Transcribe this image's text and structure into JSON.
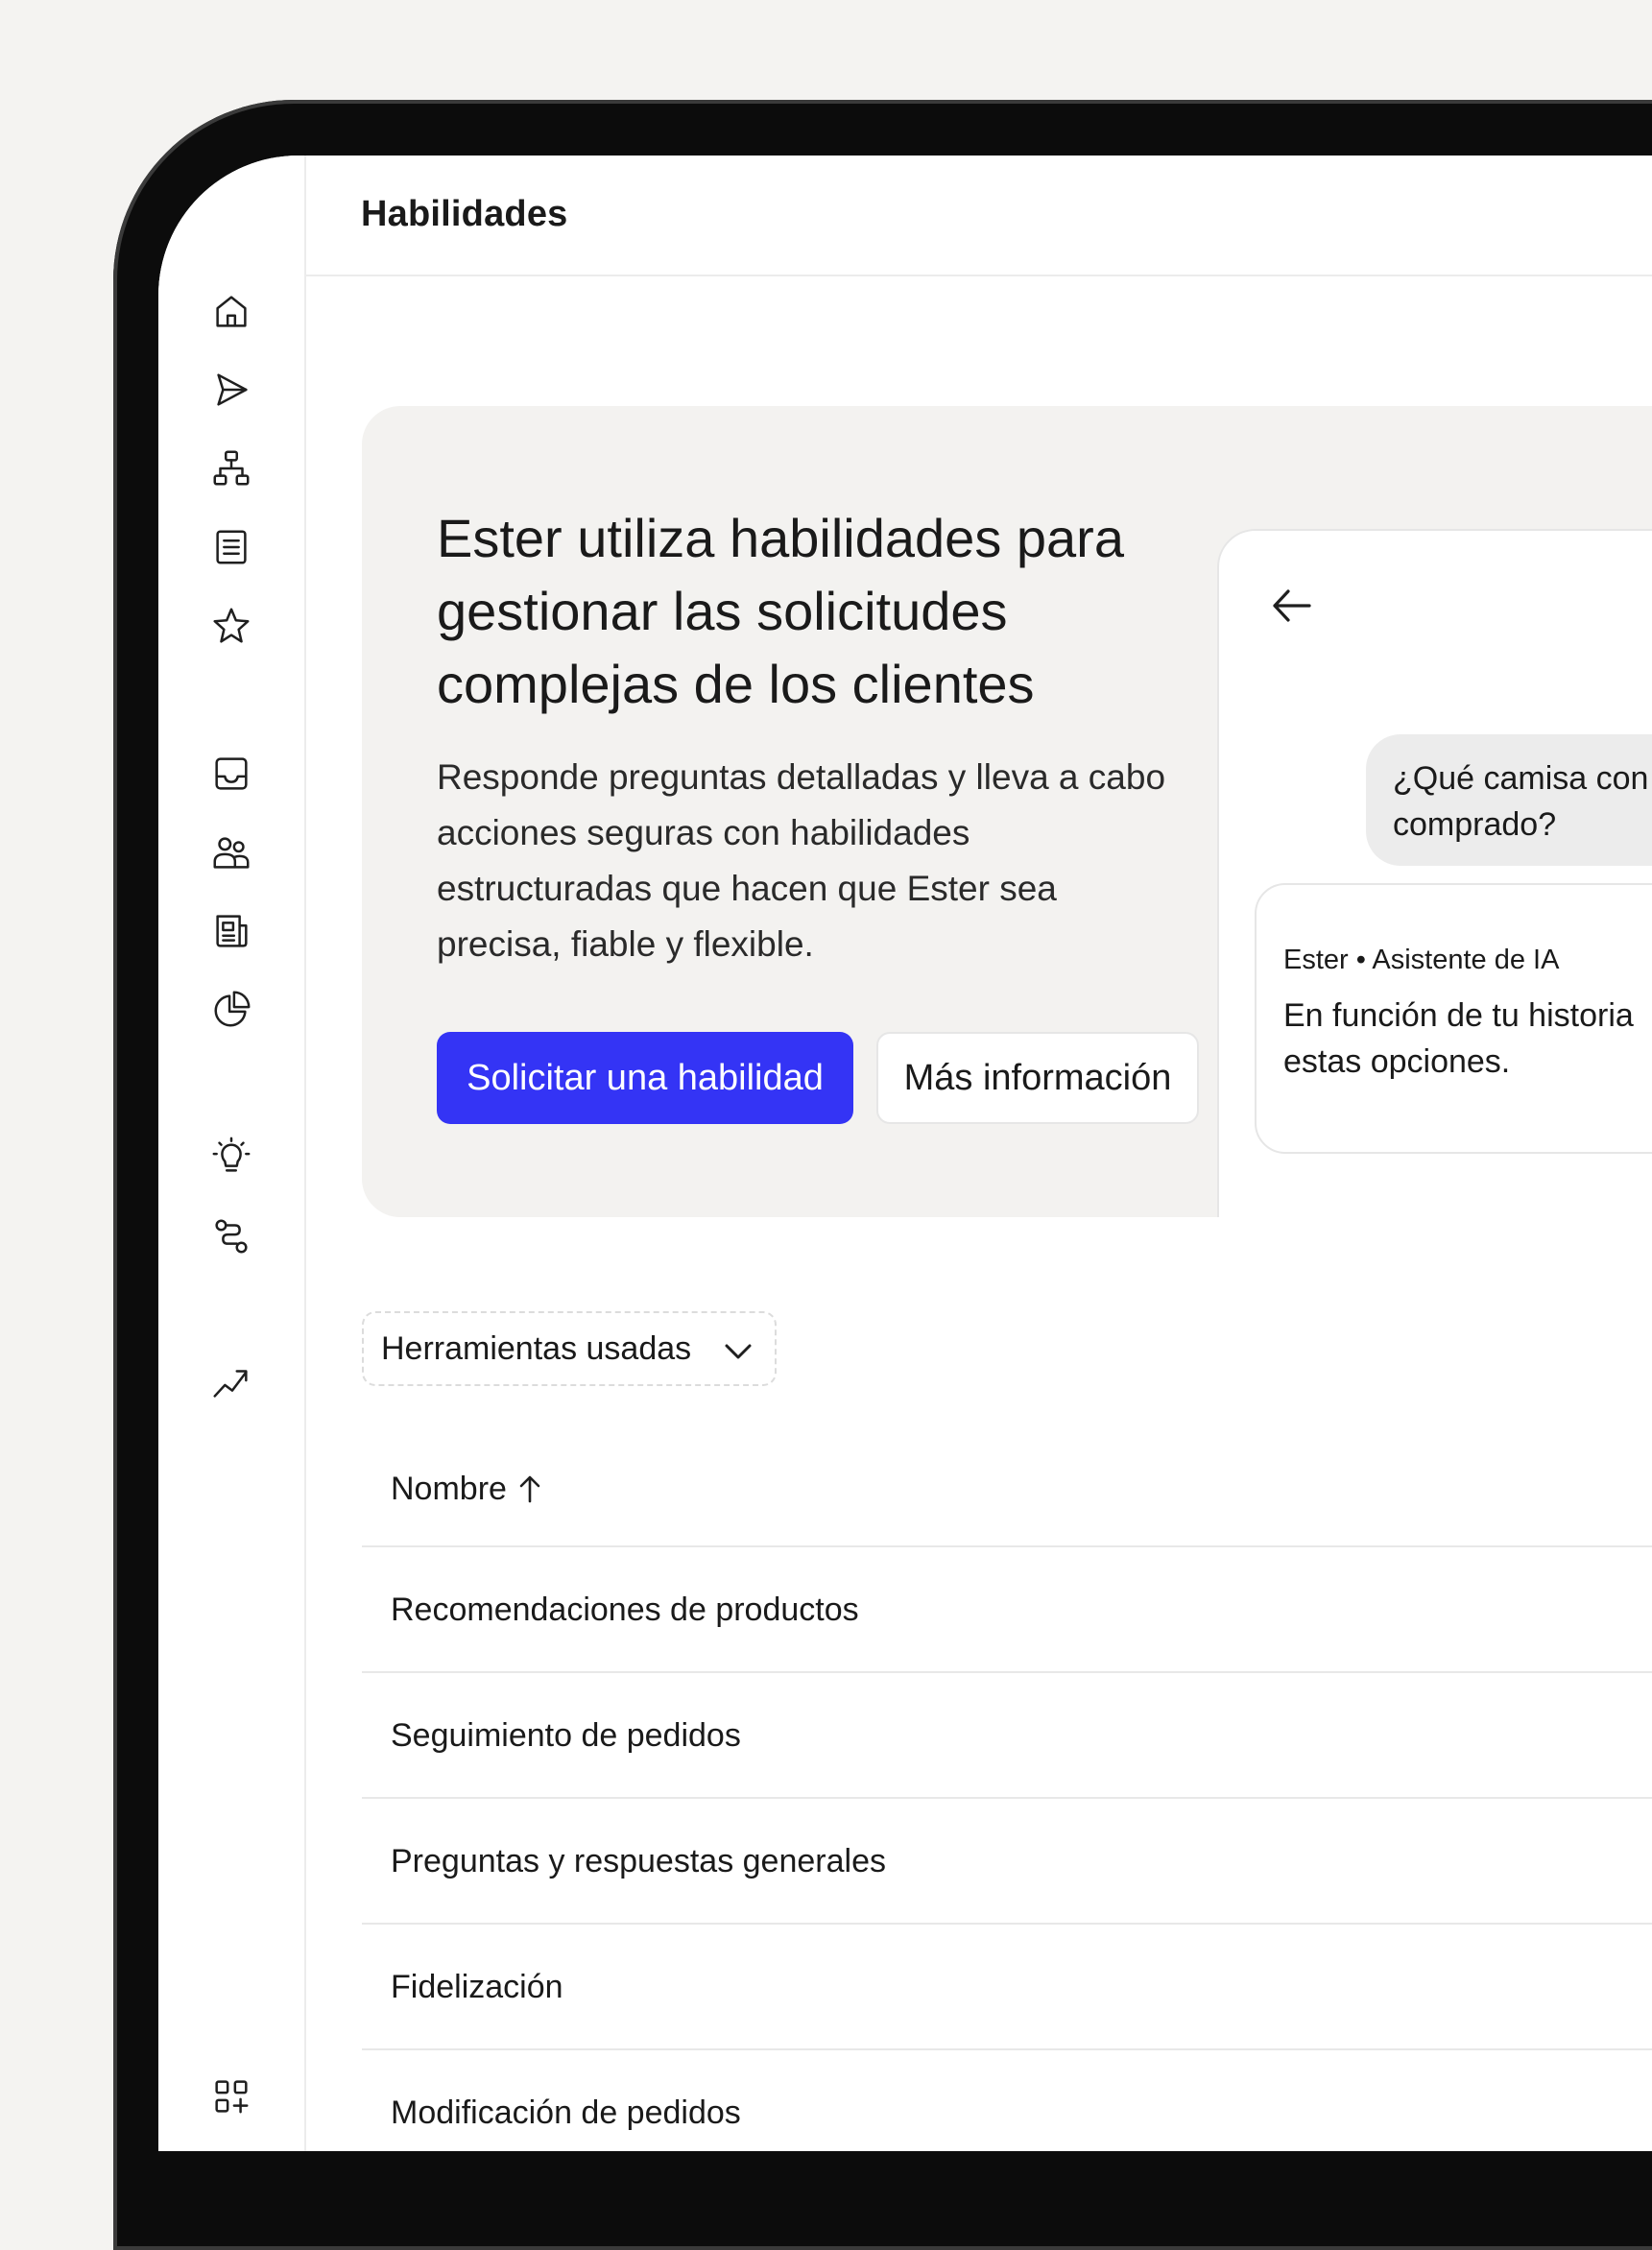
{
  "header": {
    "title": "Habilidades"
  },
  "sidebar": {
    "items": [
      {
        "icon": "home-icon"
      },
      {
        "icon": "send-icon"
      },
      {
        "icon": "org-chart-icon"
      },
      {
        "icon": "document-list-icon"
      },
      {
        "icon": "star-icon"
      },
      {
        "icon": "inbox-icon"
      },
      {
        "icon": "users-icon"
      },
      {
        "icon": "newspaper-icon"
      },
      {
        "icon": "pie-chart-icon"
      },
      {
        "icon": "lightbulb-icon"
      },
      {
        "icon": "workflow-icon"
      },
      {
        "icon": "trend-up-icon"
      },
      {
        "icon": "apps-add-icon"
      }
    ]
  },
  "hero": {
    "title": "Ester utiliza habilidades para gestionar las solicitudes complejas de los clientes",
    "description": "Responde preguntas detalladas y lleva a cabo acciones seguras con habilidades estructuradas que hacen que Ester sea precisa, fiable y flexible.",
    "primary_button": "Solicitar una habilidad",
    "secondary_button": "Más información"
  },
  "chat_preview": {
    "user_message": "¿Qué camisa con\ncomprado?",
    "ai_sender": "Ester • Asistente de IA",
    "ai_message": "En función de tu historia\nestas opciones."
  },
  "filter": {
    "label": "Herramientas usadas"
  },
  "table": {
    "column_header": "Nombre",
    "rows": [
      "Recomendaciones de productos",
      "Seguimiento de pedidos",
      "Preguntas y respuestas generales",
      "Fidelización",
      "Modificación de pedidos"
    ]
  },
  "colors": {
    "accent": "#3434f5",
    "panel": "#f3f2f0",
    "page": "#f4f3f1"
  }
}
